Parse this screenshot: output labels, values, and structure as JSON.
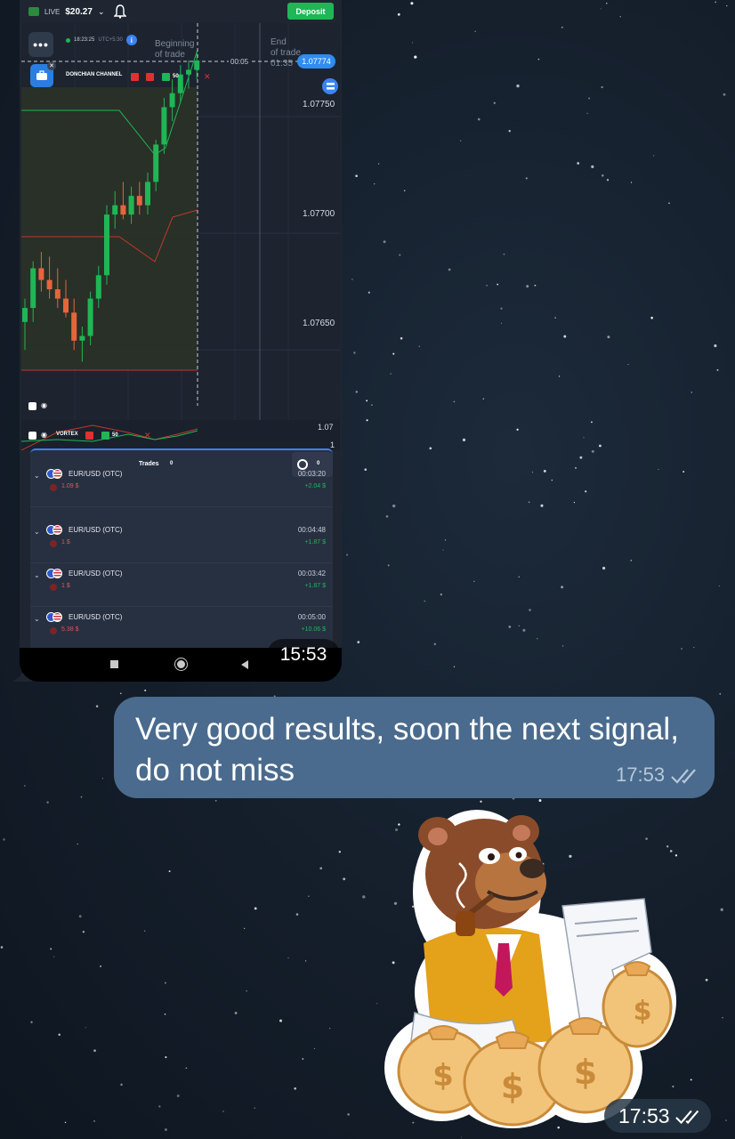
{
  "trading_app": {
    "account": {
      "mode": "LIVE",
      "balance": "$20.27"
    },
    "deposit_label": "Deposit",
    "server_time": "18:23:25",
    "timezone": "UTC+5:30",
    "indicator_main": {
      "name": "DONCHIAN CHANNEL",
      "value": "50"
    },
    "indicator_sub": {
      "name": "VORTEX",
      "value": "50"
    },
    "price_now": "1.07774",
    "price_levels": [
      "1.07750",
      "1.07700",
      "1.07650"
    ],
    "sub_levels": [
      "1.07",
      "1"
    ],
    "countdown": "00:05",
    "beginning_label_1": "Beginning",
    "beginning_label_2": "of trade",
    "end_label_1": "End",
    "end_label_2": "of trade",
    "end_time": "01:35",
    "trades_title": "Trades",
    "trades_count": "0",
    "history_count": "0",
    "trades": [
      {
        "pair": "EUR/USD (OTC)",
        "stake": "1.09 $",
        "time": "00:03:20",
        "payout": "+2.04 $"
      },
      {
        "pair": "EUR/USD (OTC)",
        "stake": "1 $",
        "time": "00:04:48",
        "payout": "+1.87 $"
      },
      {
        "pair": "EUR/USD (OTC)",
        "stake": "1 $",
        "time": "00:03:42",
        "payout": "+1.87 $"
      },
      {
        "pair": "EUR/USD (OTC)",
        "stake": "5.38 $",
        "time": "00:05:00",
        "payout": "+10.06 $"
      }
    ]
  },
  "screenshot_time": "15:53",
  "message": {
    "text": "Very good results, soon the next signal, do not miss",
    "time": "17:53"
  },
  "sticker": {
    "description": "bear-with-money-bags",
    "time": "17:53"
  },
  "colors": {
    "bubble_outgoing": "#4a6b8d",
    "bull": "#1fb655",
    "bear": "#e8643a",
    "accent": "#3b82f6"
  },
  "chart_data": {
    "type": "candlestick",
    "ylim": [
      1.0762,
      1.0779
    ],
    "candles": [
      {
        "o": 1.07662,
        "h": 1.07672,
        "l": 1.0765,
        "c": 1.07668
      },
      {
        "o": 1.07668,
        "h": 1.07688,
        "l": 1.07662,
        "c": 1.07685
      },
      {
        "o": 1.07685,
        "h": 1.07692,
        "l": 1.07675,
        "c": 1.0768
      },
      {
        "o": 1.0768,
        "h": 1.0769,
        "l": 1.07672,
        "c": 1.07676
      },
      {
        "o": 1.07676,
        "h": 1.07685,
        "l": 1.07668,
        "c": 1.07672
      },
      {
        "o": 1.07672,
        "h": 1.0768,
        "l": 1.07664,
        "c": 1.07666
      },
      {
        "o": 1.07666,
        "h": 1.07672,
        "l": 1.0765,
        "c": 1.07654
      },
      {
        "o": 1.07654,
        "h": 1.0766,
        "l": 1.07645,
        "c": 1.07656
      },
      {
        "o": 1.07656,
        "h": 1.07675,
        "l": 1.07652,
        "c": 1.07672
      },
      {
        "o": 1.07672,
        "h": 1.07686,
        "l": 1.07668,
        "c": 1.07682
      },
      {
        "o": 1.07682,
        "h": 1.07712,
        "l": 1.07678,
        "c": 1.07708
      },
      {
        "o": 1.07708,
        "h": 1.07718,
        "l": 1.07702,
        "c": 1.07712
      },
      {
        "o": 1.07712,
        "h": 1.07722,
        "l": 1.07706,
        "c": 1.07708
      },
      {
        "o": 1.07708,
        "h": 1.0772,
        "l": 1.07704,
        "c": 1.07716
      },
      {
        "o": 1.07716,
        "h": 1.07722,
        "l": 1.07708,
        "c": 1.07712
      },
      {
        "o": 1.07712,
        "h": 1.07726,
        "l": 1.07708,
        "c": 1.07722
      },
      {
        "o": 1.07722,
        "h": 1.0774,
        "l": 1.07718,
        "c": 1.07738
      },
      {
        "o": 1.07738,
        "h": 1.07758,
        "l": 1.07734,
        "c": 1.07754
      },
      {
        "o": 1.07754,
        "h": 1.07766,
        "l": 1.07748,
        "c": 1.0776
      },
      {
        "o": 1.0776,
        "h": 1.07772,
        "l": 1.07756,
        "c": 1.07768
      },
      {
        "o": 1.07768,
        "h": 1.07774,
        "l": 1.07762,
        "c": 1.0777
      },
      {
        "o": 1.0777,
        "h": 1.07778,
        "l": 1.07766,
        "c": 1.07774
      }
    ]
  }
}
